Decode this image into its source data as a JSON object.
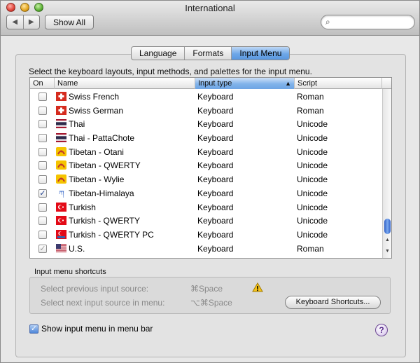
{
  "window": {
    "title": "International"
  },
  "toolbar": {
    "back_label": "◀",
    "forward_label": "▶",
    "show_all_label": "Show All",
    "search_placeholder": ""
  },
  "tabs": [
    {
      "label": "Language",
      "active": false
    },
    {
      "label": "Formats",
      "active": false
    },
    {
      "label": "Input Menu",
      "active": true
    }
  ],
  "instructions": "Select the keyboard layouts, input methods, and palettes for the input menu.",
  "table": {
    "headers": {
      "on": "On",
      "name": "Name",
      "type": "Input type",
      "script": "Script",
      "sort_indicator": "▲"
    },
    "rows": [
      {
        "checked": false,
        "flag": "swiss",
        "name": "Swiss French",
        "type": "Keyboard",
        "script": "Roman"
      },
      {
        "checked": false,
        "flag": "swiss",
        "name": "Swiss German",
        "type": "Keyboard",
        "script": "Roman"
      },
      {
        "checked": false,
        "flag": "thai",
        "name": "Thai",
        "type": "Keyboard",
        "script": "Unicode"
      },
      {
        "checked": false,
        "flag": "thai",
        "name": "Thai - PattaChote",
        "type": "Keyboard",
        "script": "Unicode"
      },
      {
        "checked": false,
        "flag": "tibetan-yellow",
        "name": "Tibetan - Otani",
        "type": "Keyboard",
        "script": "Unicode"
      },
      {
        "checked": false,
        "flag": "tibetan-yellow",
        "name": "Tibetan - QWERTY",
        "type": "Keyboard",
        "script": "Unicode"
      },
      {
        "checked": false,
        "flag": "tibetan-yellow",
        "name": "Tibetan - Wylie",
        "type": "Keyboard",
        "script": "Unicode"
      },
      {
        "checked": true,
        "flag": "tibetan-glyph",
        "name": "Tibetan-Himalaya",
        "type": "Keyboard",
        "script": "Unicode"
      },
      {
        "checked": false,
        "flag": "turkish",
        "name": "Turkish",
        "type": "Keyboard",
        "script": "Unicode"
      },
      {
        "checked": false,
        "flag": "turkish",
        "name": "Turkish - QWERTY",
        "type": "Keyboard",
        "script": "Unicode"
      },
      {
        "checked": false,
        "flag": "turkish-pc",
        "name": "Turkish - QWERTY PC",
        "type": "Keyboard",
        "script": "Unicode"
      },
      {
        "checked": true,
        "dim": true,
        "flag": "us",
        "name": "U.S.",
        "type": "Keyboard",
        "script": "Roman"
      }
    ]
  },
  "shortcuts": {
    "title": "Input menu shortcuts",
    "prev_label": "Select previous input source:",
    "prev_key": "⌘Space",
    "next_label": "Select next input source in menu:",
    "next_key": "⌥⌘Space",
    "button_label": "Keyboard Shortcuts..."
  },
  "show_menu": {
    "label": "Show input menu in menu bar",
    "checked": true
  },
  "help_label": "?",
  "icons": {
    "search": "magnifier-icon",
    "warning": "warning-icon",
    "help": "help-icon"
  }
}
